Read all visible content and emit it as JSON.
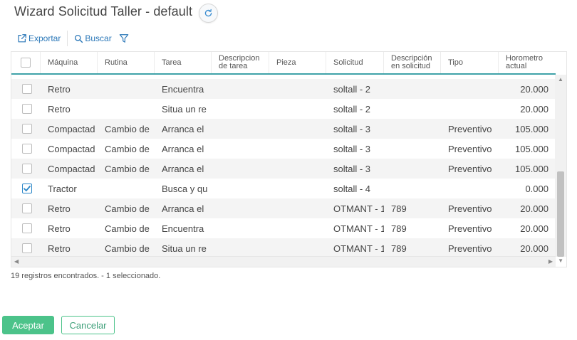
{
  "window": {
    "title": "Wizard Solicitud Taller - default"
  },
  "toolbar": {
    "export_label": "Exportar",
    "search_label": "Buscar"
  },
  "grid": {
    "columns": [
      "",
      "Máquina",
      "Rutina",
      "Tarea",
      "Descripcion de tarea",
      "Pieza",
      "Solicitud",
      "Descripción en solicitud",
      "Tipo",
      "Horometro actual"
    ],
    "rows": [
      {
        "checked": false,
        "maquina": "Retro",
        "rutina": "",
        "tarea": "Encuentra",
        "descripcion": "",
        "pieza": "",
        "solicitud": "soltall - 2",
        "desc_solicitud": "",
        "tipo": "",
        "horometro": "20.000"
      },
      {
        "checked": false,
        "maquina": "Retro",
        "rutina": "",
        "tarea": "Situa un re",
        "descripcion": "",
        "pieza": "",
        "solicitud": "soltall - 2",
        "desc_solicitud": "",
        "tipo": "",
        "horometro": "20.000"
      },
      {
        "checked": false,
        "maquina": "Compactad",
        "rutina": "Cambio de",
        "tarea": "Arranca el",
        "descripcion": "",
        "pieza": "",
        "solicitud": "soltall - 3",
        "desc_solicitud": "",
        "tipo": "Preventivo",
        "horometro": "105.000"
      },
      {
        "checked": false,
        "maquina": "Compactad",
        "rutina": "Cambio de",
        "tarea": "Arranca el",
        "descripcion": "",
        "pieza": "",
        "solicitud": "soltall - 3",
        "desc_solicitud": "",
        "tipo": "Preventivo",
        "horometro": "105.000"
      },
      {
        "checked": false,
        "maquina": "Compactad",
        "rutina": "Cambio de",
        "tarea": "Arranca el",
        "descripcion": "",
        "pieza": "",
        "solicitud": "soltall - 3",
        "desc_solicitud": "",
        "tipo": "Preventivo",
        "horometro": "105.000"
      },
      {
        "checked": true,
        "maquina": "Tractor",
        "rutina": "",
        "tarea": "Busca y qu",
        "descripcion": "",
        "pieza": "",
        "solicitud": "soltall - 4",
        "desc_solicitud": "",
        "tipo": "",
        "horometro": "0.000"
      },
      {
        "checked": false,
        "maquina": "Retro",
        "rutina": "Cambio de",
        "tarea": "Arranca el",
        "descripcion": "",
        "pieza": "",
        "solicitud": "OTMANT - 1",
        "desc_solicitud": "789",
        "tipo": "Preventivo",
        "horometro": "20.000"
      },
      {
        "checked": false,
        "maquina": "Retro",
        "rutina": "Cambio de",
        "tarea": "Encuentra",
        "descripcion": "",
        "pieza": "",
        "solicitud": "OTMANT - 1",
        "desc_solicitud": "789",
        "tipo": "Preventivo",
        "horometro": "20.000"
      },
      {
        "checked": false,
        "maquina": "Retro",
        "rutina": "Cambio de",
        "tarea": "Situa un re",
        "descripcion": "",
        "pieza": "",
        "solicitud": "OTMANT - 1",
        "desc_solicitud": "789",
        "tipo": "Preventivo",
        "horometro": "20.000"
      }
    ]
  },
  "status": {
    "text": "19 registros encontrados. - 1 seleccionado."
  },
  "footer": {
    "accept_label": "Aceptar",
    "cancel_label": "Cancelar"
  },
  "colors": {
    "accent": "#3fa2a8",
    "primary_button": "#4cc38a",
    "link": "#2a77b8",
    "check": "#2a86c8"
  },
  "icons": {
    "refresh": "refresh-icon",
    "export": "export-icon",
    "search": "search-icon",
    "filter": "filter-icon",
    "check": "check-icon"
  }
}
